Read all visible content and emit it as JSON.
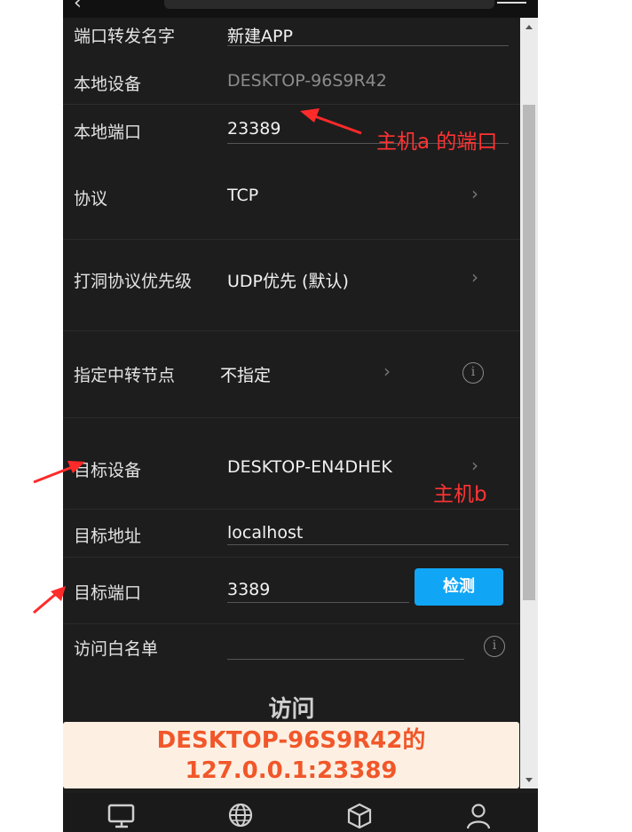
{
  "form": {
    "forward_name_label": "端口转发名字",
    "forward_name_value": "新建APP",
    "local_device_label": "本地设备",
    "local_device_value": "DESKTOP-96S9R42",
    "local_port_label": "本地端口",
    "local_port_value": "23389",
    "protocol_label": "协议",
    "protocol_value": "TCP",
    "punch_priority_label": "打洞协议优先级",
    "punch_priority_value": "UDP优先 (默认)",
    "relay_node_label": "指定中转节点",
    "relay_node_value": "不指定",
    "target_device_label": "目标设备",
    "target_device_value": "DESKTOP-EN4DHEK",
    "target_address_label": "目标地址",
    "target_address_value": "localhost",
    "target_port_label": "目标端口",
    "target_port_value": "3389",
    "detect_button": "检测",
    "whitelist_label": "访问白名单",
    "whitelist_value": ""
  },
  "access": {
    "title": "访问",
    "line1": "DESKTOP-96S9R42的",
    "line2": "127.0.0.1:23389"
  },
  "annotations": {
    "host_a_port": "主机a 的端口",
    "host_b": "主机b"
  },
  "icons": {
    "chevron": "›",
    "info": "i"
  },
  "bottom_nav": [
    "monitor-icon",
    "globe-icon",
    "cube-icon",
    "user-icon"
  ],
  "colors": {
    "background": "#1d1d1d",
    "accent": "#10a6f5",
    "callout_bg": "#fdf0e3",
    "callout_text": "#f1572a",
    "annotation": "#ff3333"
  }
}
